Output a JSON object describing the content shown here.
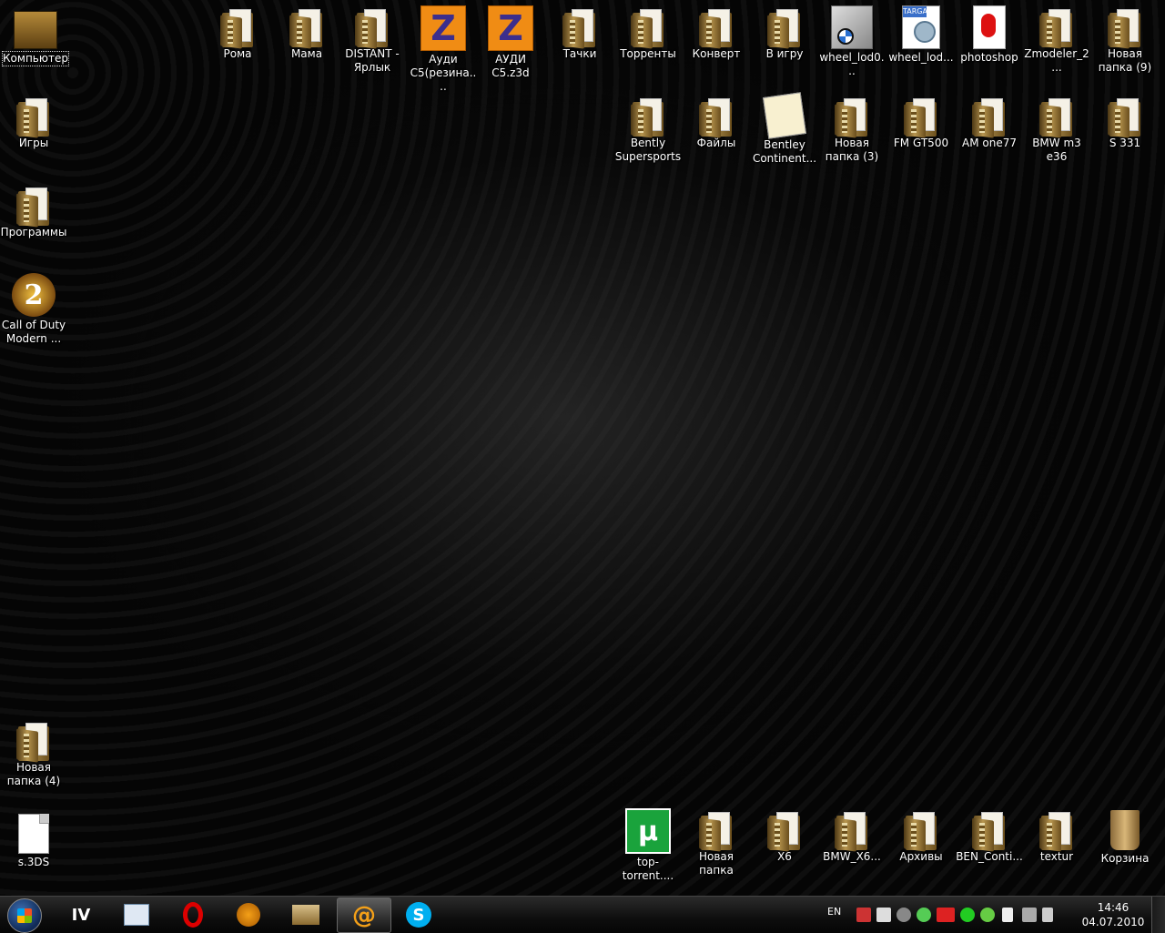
{
  "desktop": {
    "computer": "Компьютер",
    "games": "Игры",
    "programs": "Программы",
    "cod": "Call of Duty Modern ...",
    "new_folder_4": "Новая папка (4)",
    "s3ds": "s.3DS",
    "top_row": [
      "Рома",
      "Мама",
      "DISTANT - Ярлык",
      "Ауди C5(резина....",
      "АУДИ C5.z3d",
      "Тачки",
      "Торренты",
      "Конверт",
      "В игру",
      "wheel_lod0...",
      "wheel_lod...",
      "photoshop",
      "Zmodeler_2...",
      "Новая папка (9)"
    ],
    "second_row": [
      "Bently Supersports",
      "Файлы",
      "Bentley Continent...",
      "Новая папка (3)",
      "FM GT500",
      "AM one77",
      "BMW m3 e36",
      "S 331"
    ],
    "bottom_row": [
      "top-torrent....",
      "Новая папка",
      "X6",
      "BMW_X6...",
      "Архивы",
      "BEN_Conti...",
      "textur",
      "Корзина"
    ]
  },
  "taskbar": {
    "pinned": [
      "gta-iv",
      "explorer",
      "opera",
      "aimp",
      "folder",
      "mail-agent",
      "skype"
    ],
    "active_index": 5,
    "gta_label": "IV",
    "mail_label": "@"
  },
  "tray": {
    "lang": "EN",
    "time": "14:46",
    "date": "04.07.2010"
  }
}
